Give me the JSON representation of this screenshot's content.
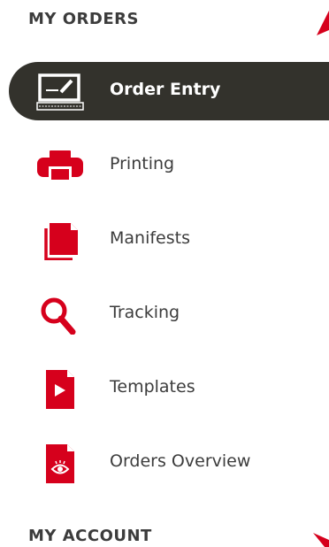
{
  "sections": [
    {
      "title": "MY ORDERS"
    },
    {
      "title": "MY ACCOUNT"
    }
  ],
  "menu": [
    {
      "label": "Order Entry",
      "icon": "order-entry-icon",
      "active": true
    },
    {
      "label": "Printing",
      "icon": "printer-icon",
      "active": false
    },
    {
      "label": "Manifests",
      "icon": "manifest-icon",
      "active": false
    },
    {
      "label": "Tracking",
      "icon": "search-icon",
      "active": false
    },
    {
      "label": "Templates",
      "icon": "template-icon",
      "active": false
    },
    {
      "label": "Orders Overview",
      "icon": "eye-document-icon",
      "active": false
    }
  ],
  "colors": {
    "accent": "#d6001c",
    "active_bg": "#33322c",
    "text": "#3c3c3c"
  }
}
